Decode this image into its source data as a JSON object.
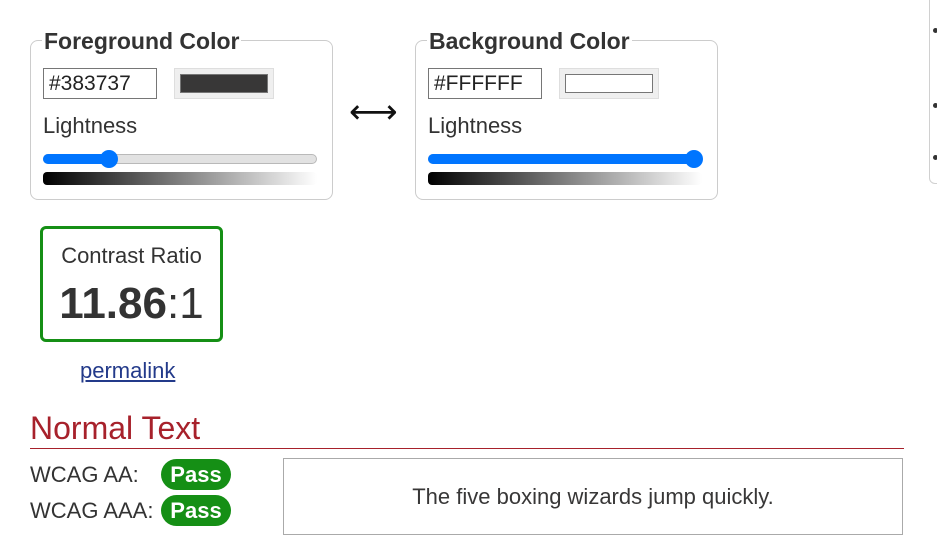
{
  "foreground": {
    "title": "Foreground Color",
    "hex_value": "#383737",
    "swatch_color": "#383737",
    "lightness_label": "Lightness",
    "lightness_percent": 22
  },
  "swap_symbol": "⟷",
  "background": {
    "title": "Background Color",
    "hex_value": "#FFFFFF",
    "swatch_color": "#FFFFFF",
    "lightness_label": "Lightness",
    "lightness_percent": 100
  },
  "contrast": {
    "caption": "Contrast Ratio",
    "ratio": "11.86",
    "suffix": ":1",
    "border_color": "#158f15"
  },
  "permalink_label": "permalink",
  "normal_text": {
    "title": "Normal Text",
    "results": [
      {
        "label": "WCAG AA:",
        "status": "Pass"
      },
      {
        "label": "WCAG AAA:",
        "status": "Pass"
      }
    ],
    "sample": "The five boxing wizards jump quickly."
  },
  "colors": {
    "accent": "#0075ff",
    "pass": "#158f15",
    "heading": "#a7212b",
    "link": "#233a8a"
  }
}
